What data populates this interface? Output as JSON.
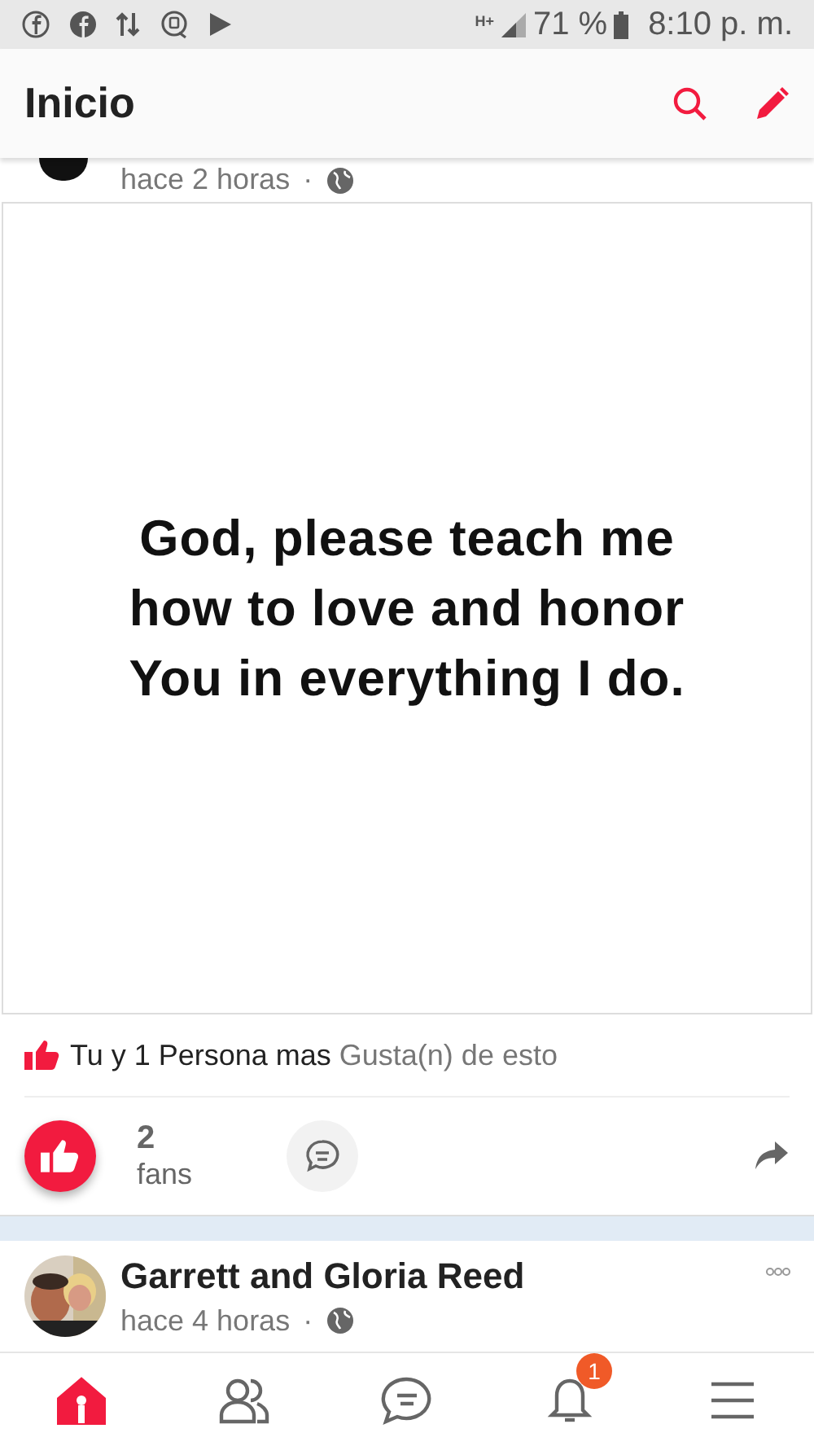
{
  "status_bar": {
    "network": "H+",
    "battery": "71 %",
    "time": "8:10 p. m."
  },
  "app_bar": {
    "title": "Inicio"
  },
  "posts": [
    {
      "time": "hace 2 horas",
      "separator": "·",
      "image_text": "God, please teach me how to love and honor You in everything I do.",
      "likes": {
        "who": "Tu y 1 Persona mas",
        "suffix": "Gusta(n) de esto"
      },
      "liked": true,
      "fan_count": "2",
      "fan_label": "fans"
    },
    {
      "author": "Garrett and Gloria Reed",
      "time": "hace 4 horas",
      "separator": "·"
    }
  ],
  "nav": [
    {
      "kind": "home",
      "selected": true
    },
    {
      "kind": "groups",
      "selected": false
    },
    {
      "kind": "chat",
      "selected": false
    },
    {
      "kind": "bell",
      "selected": false,
      "badge": "1"
    },
    {
      "kind": "menu",
      "selected": false
    }
  ]
}
